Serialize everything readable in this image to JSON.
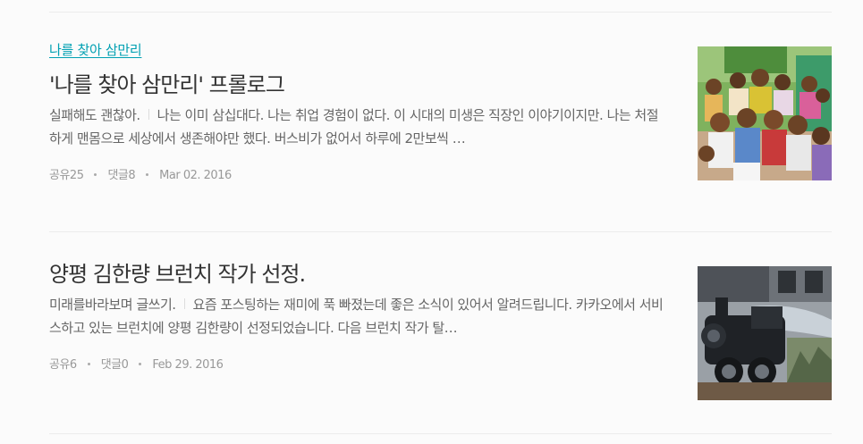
{
  "posts": [
    {
      "category": "나를 찾아 삼만리",
      "title": "'나를 찾아 삼만리' 프롤로그",
      "subtitle": "실패해도 괜찮아.",
      "excerpt": "나는 이미 삼십대다. 나는 취업 경험이 없다. 이 시대의 미생은 직장인 이야기이지만. 나는 처절하게 맨몸으로 세상에서 생존해야만 했다. 버스비가 없어서 하루에 2만보씩 …",
      "shares": "공유25",
      "comments": "댓글8",
      "date": "Mar 02. 2016",
      "thumbnail_icon": "children-group-photo"
    },
    {
      "title": "양평 김한량 브런치 작가 선정.",
      "subtitle": "미래를바라보며 글쓰기.",
      "excerpt": "요즘 포스팅하는 재미에 푹 빠졌는데 좋은 소식이 있어서 알려드립니다. 카카오에서 서비스하고 있는 브런치에 양평 김한량이 선정되었습니다. 다음 브런치 작가 탈…",
      "shares": "공유6",
      "comments": "댓글0",
      "date": "Feb 29. 2016",
      "thumbnail_icon": "steam-locomotive-mural-photo"
    }
  ]
}
